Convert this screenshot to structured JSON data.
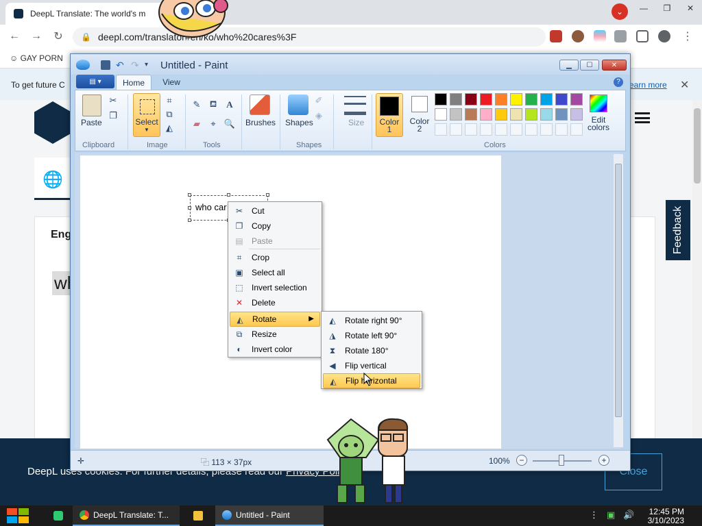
{
  "browser": {
    "tab_title": "DeepL Translate: The world's m",
    "url": "deepl.com/translator#en/ko/who%20cares%3F",
    "bookmark_label": "GAY PORN"
  },
  "deepl": {
    "banner_text": "To get future C",
    "banner_link": "earn more",
    "source_lang": "Eng",
    "source_text": "wh",
    "feedback_label": "Feedback",
    "cookie_text_prefix": "DeepL uses cookies. For further details, please read our ",
    "cookie_link": "Privacy Policy",
    "cookie_text_suffix": ".",
    "cookie_close": "Close"
  },
  "paint": {
    "title": "Untitled - Paint",
    "tabs": [
      "Home",
      "View"
    ],
    "buttons": {
      "paste": "Paste",
      "select": "Select",
      "brushes": "Brushes",
      "shapes": "Shapes",
      "size": "Size",
      "color1": "Color 1",
      "color2": "Color 2",
      "edit_colors": "Edit colors"
    },
    "groups": {
      "clipboard": "Clipboard",
      "image": "Image",
      "tools": "Tools",
      "shapes": "Shapes",
      "colors": "Colors"
    },
    "palette_row1": [
      "#000000",
      "#7f7f7f",
      "#880015",
      "#ed1c24",
      "#ff7f27",
      "#fff200",
      "#22b14c",
      "#00a2e8",
      "#3f48cc",
      "#a349a4"
    ],
    "palette_row2": [
      "#ffffff",
      "#c3c3c3",
      "#b97a57",
      "#ffaec9",
      "#ffc90e",
      "#efe4b0",
      "#b5e61d",
      "#99d9ea",
      "#7092be",
      "#c8bfe7"
    ],
    "canvas_text": "who car",
    "status": {
      "selection_size": "113 × 37px",
      "zoom": "100%"
    }
  },
  "context_menu": {
    "items": [
      {
        "label": "Cut",
        "icon": "scissors-icon",
        "disabled": false
      },
      {
        "label": "Copy",
        "icon": "copy-icon",
        "disabled": false
      },
      {
        "label": "Paste",
        "icon": "paste-icon",
        "disabled": true
      },
      {
        "label": "Crop",
        "icon": "crop-icon",
        "disabled": false
      },
      {
        "label": "Select all",
        "icon": "select-all-icon",
        "disabled": false
      },
      {
        "label": "Invert selection",
        "icon": "invert-selection-icon",
        "disabled": false
      },
      {
        "label": "Delete",
        "icon": "delete-icon",
        "disabled": false
      },
      {
        "label": "Rotate",
        "icon": "rotate-icon",
        "disabled": false
      },
      {
        "label": "Resize",
        "icon": "resize-icon",
        "disabled": false
      },
      {
        "label": "Invert color",
        "icon": "invert-color-icon",
        "disabled": false
      }
    ]
  },
  "rotate_submenu": {
    "items": [
      {
        "label": "Rotate right 90°",
        "icon": "rotate-right-icon"
      },
      {
        "label": "Rotate left 90°",
        "icon": "rotate-left-icon"
      },
      {
        "label": "Rotate 180°",
        "icon": "rotate-180-icon"
      },
      {
        "label": "Flip vertical",
        "icon": "flip-vertical-icon"
      },
      {
        "label": "Flip horizontal",
        "icon": "flip-horizontal-icon"
      }
    ]
  },
  "taskbar": {
    "deepl_task": "DeepL Translate: T...",
    "paint_task": "Untitled - Paint",
    "time": "12:45 PM",
    "date": "3/10/2023"
  }
}
